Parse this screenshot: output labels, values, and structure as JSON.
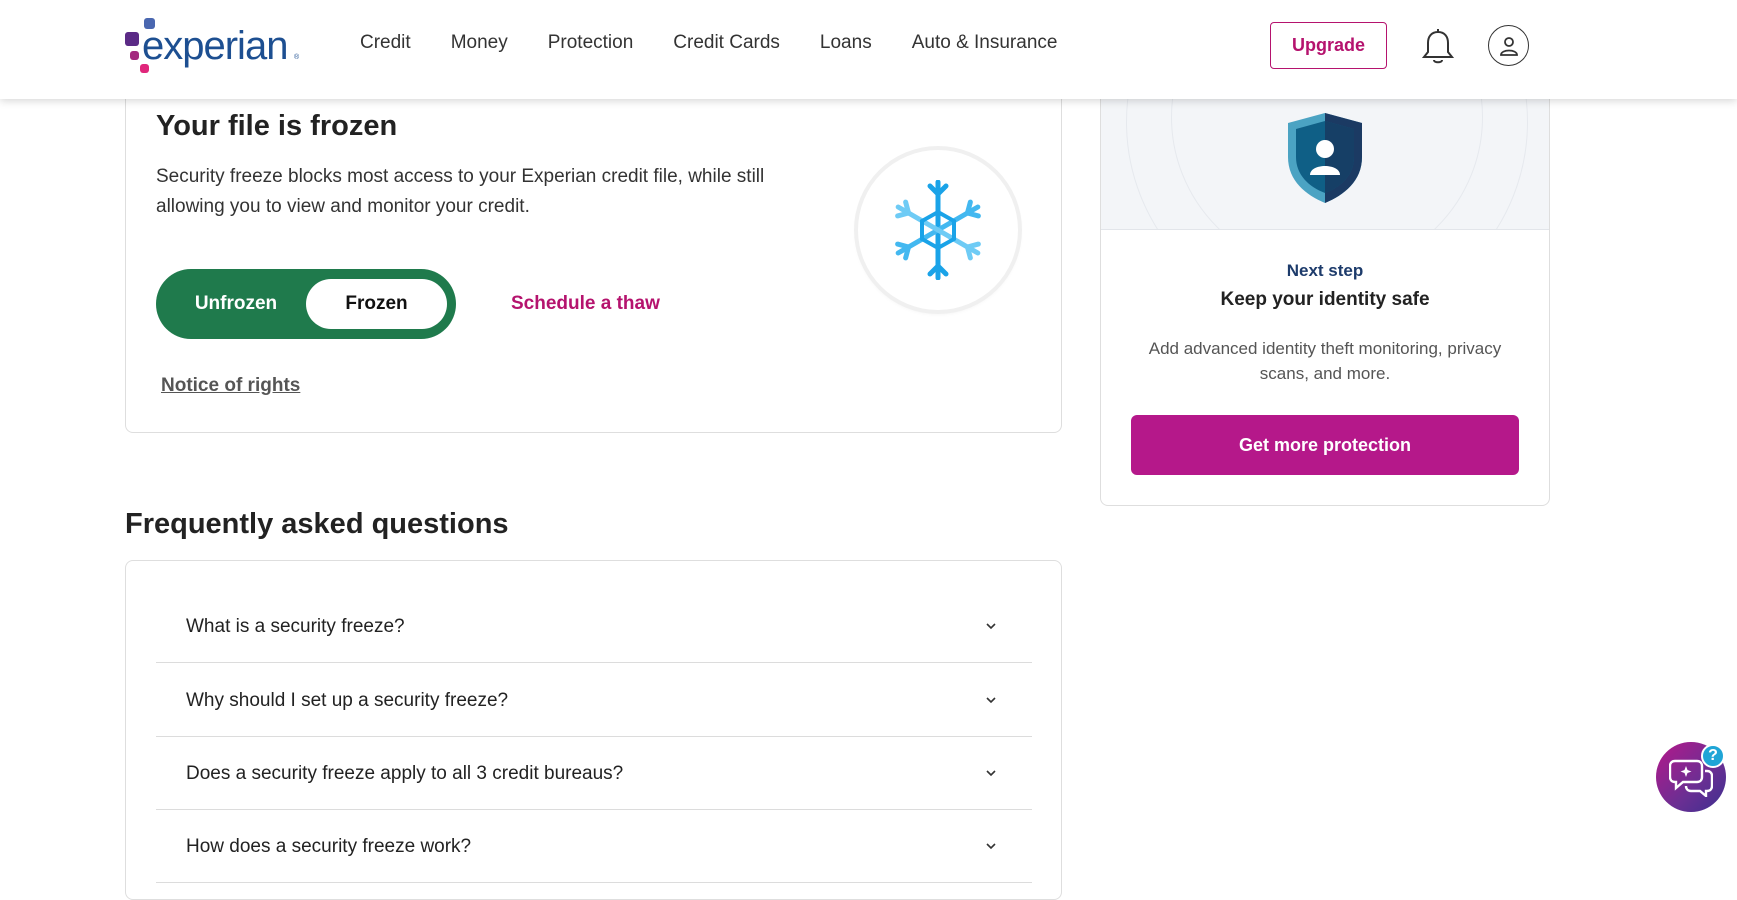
{
  "brand": {
    "name": "experian",
    "trademark": "®",
    "accent": "#b5136e",
    "primary": "#1d4f91"
  },
  "nav": {
    "items": [
      "Credit",
      "Money",
      "Protection",
      "Credit Cards",
      "Loans",
      "Auto & Insurance"
    ],
    "upgrade_label": "Upgrade",
    "notification_icon": "bell-icon",
    "profile_icon": "user-icon"
  },
  "freeze": {
    "title": "Your file is frozen",
    "description": "Security freeze blocks most access to your Experian credit file, while still allowing you to view and monitor your credit.",
    "toggle_off_label": "Unfrozen",
    "toggle_on_label": "Frozen",
    "toggle_state": "Frozen",
    "toggle_color": "#1f7a4c",
    "schedule_thaw_label": "Schedule a thaw",
    "notice_label": "Notice of rights",
    "icon": "snowflake-icon"
  },
  "faq": {
    "title": "Frequently asked questions",
    "items": [
      "What is a security freeze?",
      "Why should I set up a security freeze?",
      "Does a security freeze apply to all 3 credit bureaus?",
      "How does a security freeze work?"
    ]
  },
  "side": {
    "eyebrow": "Next step",
    "title": "Keep your identity safe",
    "description_line1": "Add advanced identity theft monitoring, privacy",
    "description_line2": "scans, and more.",
    "button_label": "Get more protection",
    "icon": "shield-user-icon",
    "button_color": "#b5188a"
  },
  "chat": {
    "icon": "chat-assistant-icon",
    "badge": "?"
  }
}
